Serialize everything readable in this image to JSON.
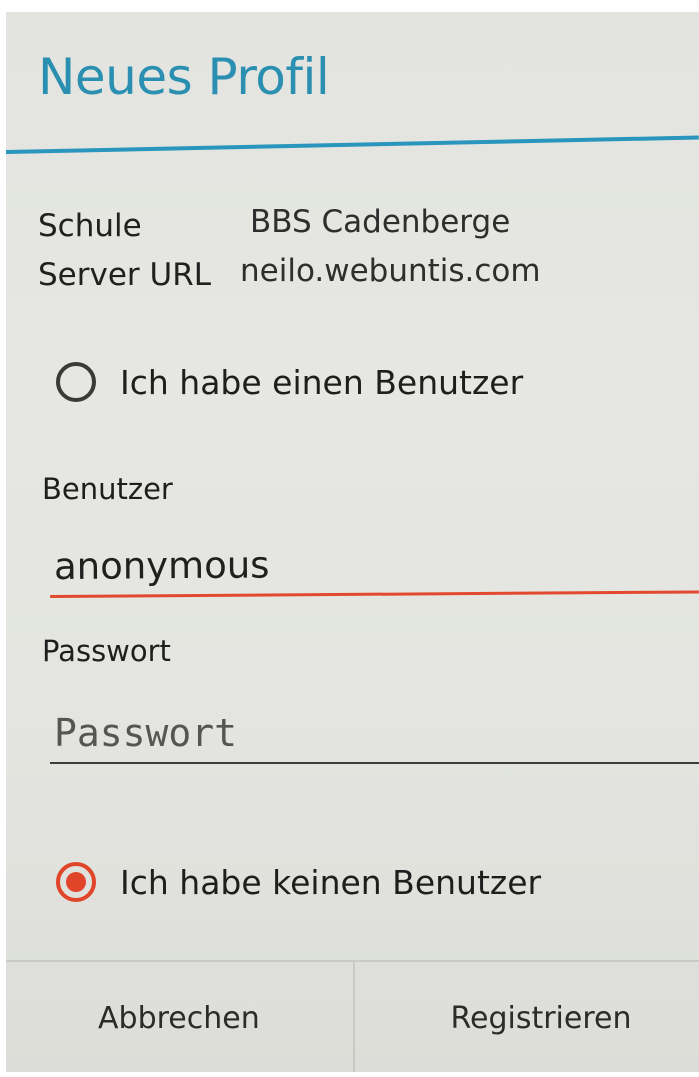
{
  "dialog": {
    "title": "Neues Profil",
    "accent_color": "#2a95bd"
  },
  "info": {
    "school_label": "Schule",
    "school_value": "BBS Cadenberge",
    "server_label": "Server URL",
    "server_value": "neilo.webuntis.com"
  },
  "options": {
    "has_user_label": "Ich habe einen Benutzer",
    "has_user_selected": false,
    "no_user_label": "Ich habe keinen Benutzer",
    "no_user_selected": true,
    "selected_color": "#e0452a"
  },
  "form": {
    "user_label": "Benutzer",
    "user_value": "anonymous",
    "password_label": "Passwort",
    "password_placeholder": "Passwort",
    "password_value": ""
  },
  "buttons": {
    "cancel_label": "Abbrechen",
    "register_label": "Registrieren"
  }
}
